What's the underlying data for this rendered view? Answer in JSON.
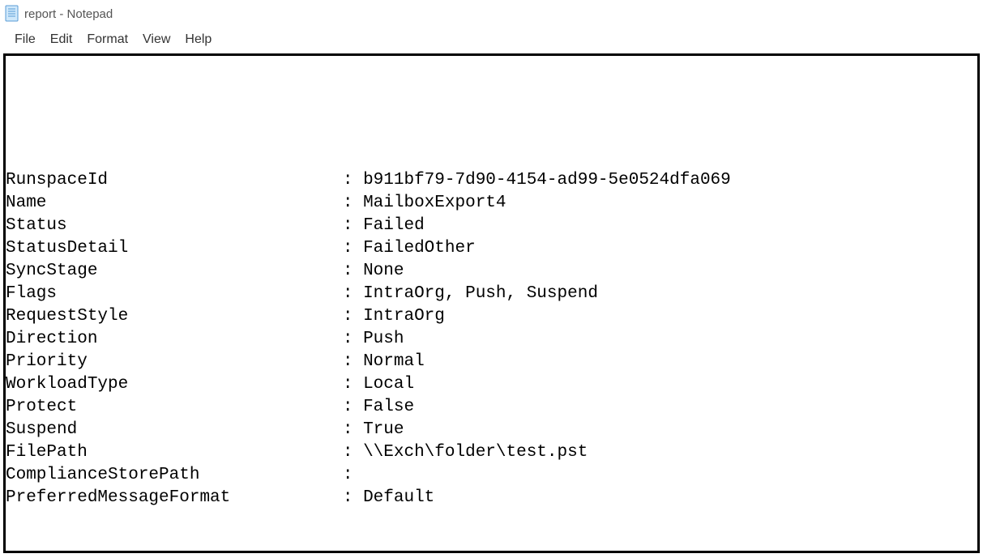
{
  "window": {
    "title": "report - Notepad"
  },
  "menu": {
    "file": "File",
    "edit": "Edit",
    "format": "Format",
    "view": "View",
    "help": "Help"
  },
  "report": {
    "key_width": 33,
    "leading_blank_lines": 5,
    "fields": [
      {
        "key": "RunspaceId",
        "value": "b911bf79-7d90-4154-ad99-5e0524dfa069"
      },
      {
        "key": "Name",
        "value": "MailboxExport4"
      },
      {
        "key": "Status",
        "value": "Failed"
      },
      {
        "key": "StatusDetail",
        "value": "FailedOther"
      },
      {
        "key": "SyncStage",
        "value": "None"
      },
      {
        "key": "Flags",
        "value": "IntraOrg, Push, Suspend"
      },
      {
        "key": "RequestStyle",
        "value": "IntraOrg"
      },
      {
        "key": "Direction",
        "value": "Push"
      },
      {
        "key": "Priority",
        "value": "Normal"
      },
      {
        "key": "WorkloadType",
        "value": "Local"
      },
      {
        "key": "Protect",
        "value": "False"
      },
      {
        "key": "Suspend",
        "value": "True"
      },
      {
        "key": "FilePath",
        "value": "\\\\Exch\\folder\\test.pst"
      },
      {
        "key": "ComplianceStorePath",
        "value": ""
      },
      {
        "key": "PreferredMessageFormat",
        "value": "Default"
      }
    ]
  }
}
